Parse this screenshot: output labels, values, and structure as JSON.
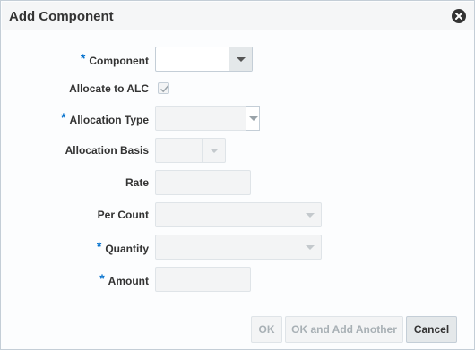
{
  "dialog": {
    "title": "Add Component",
    "close_icon": "close-icon"
  },
  "form": {
    "component": {
      "label": "Component",
      "required": true,
      "value": ""
    },
    "allocate_to_alc": {
      "label": "Allocate to ALC",
      "checked": true
    },
    "allocation_type": {
      "label": "Allocation Type",
      "required": true,
      "value": ""
    },
    "allocation_basis": {
      "label": "Allocation Basis",
      "value": ""
    },
    "rate": {
      "label": "Rate",
      "value": ""
    },
    "per_count": {
      "label": "Per Count",
      "value": ""
    },
    "quantity": {
      "label": "Quantity",
      "required": true,
      "value": ""
    },
    "amount": {
      "label": "Amount",
      "required": true,
      "value": ""
    }
  },
  "buttons": {
    "ok": "OK",
    "ok_and_add_another": "OK and Add Another",
    "cancel": "Cancel"
  },
  "required_marker": "*",
  "colors": {
    "required": "#0572ce",
    "disabled_text": "#a8b0b5"
  }
}
